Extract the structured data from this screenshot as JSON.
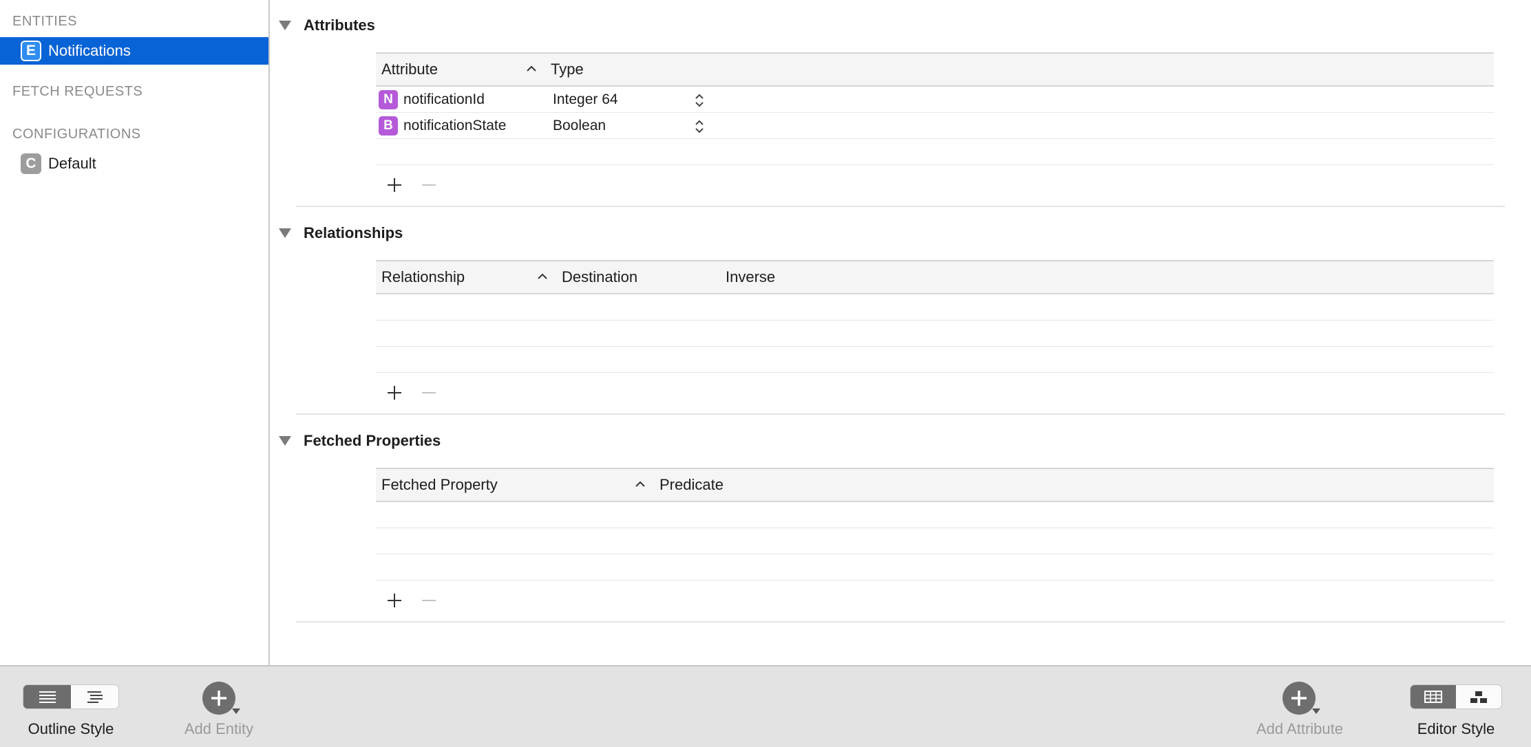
{
  "sidebar": {
    "entities_header": "ENTITIES",
    "entities": [
      {
        "badge": "E",
        "label": "Notifications",
        "selected": true
      }
    ],
    "fetch_requests_header": "FETCH REQUESTS",
    "configurations_header": "CONFIGURATIONS",
    "configurations": [
      {
        "badge": "C",
        "label": "Default"
      }
    ]
  },
  "attributes": {
    "title": "Attributes",
    "columns": [
      "Attribute",
      "Type"
    ],
    "rows": [
      {
        "badge": "N",
        "name": "notificationId",
        "type": "Integer 64"
      },
      {
        "badge": "B",
        "name": "notificationState",
        "type": "Boolean"
      }
    ]
  },
  "relationships": {
    "title": "Relationships",
    "columns": [
      "Relationship",
      "Destination",
      "Inverse"
    ]
  },
  "fetched_properties": {
    "title": "Fetched Properties",
    "columns": [
      "Fetched Property",
      "Predicate"
    ]
  },
  "toolbar": {
    "outline_style_label": "Outline Style",
    "add_entity_label": "Add Entity",
    "add_attribute_label": "Add Attribute",
    "editor_style_label": "Editor Style"
  },
  "colors": {
    "selection": "#0863d6",
    "attribute_badge": "#b45ad8",
    "entity_badge": "#2f8df0",
    "config_badge": "#9d9d9d"
  }
}
